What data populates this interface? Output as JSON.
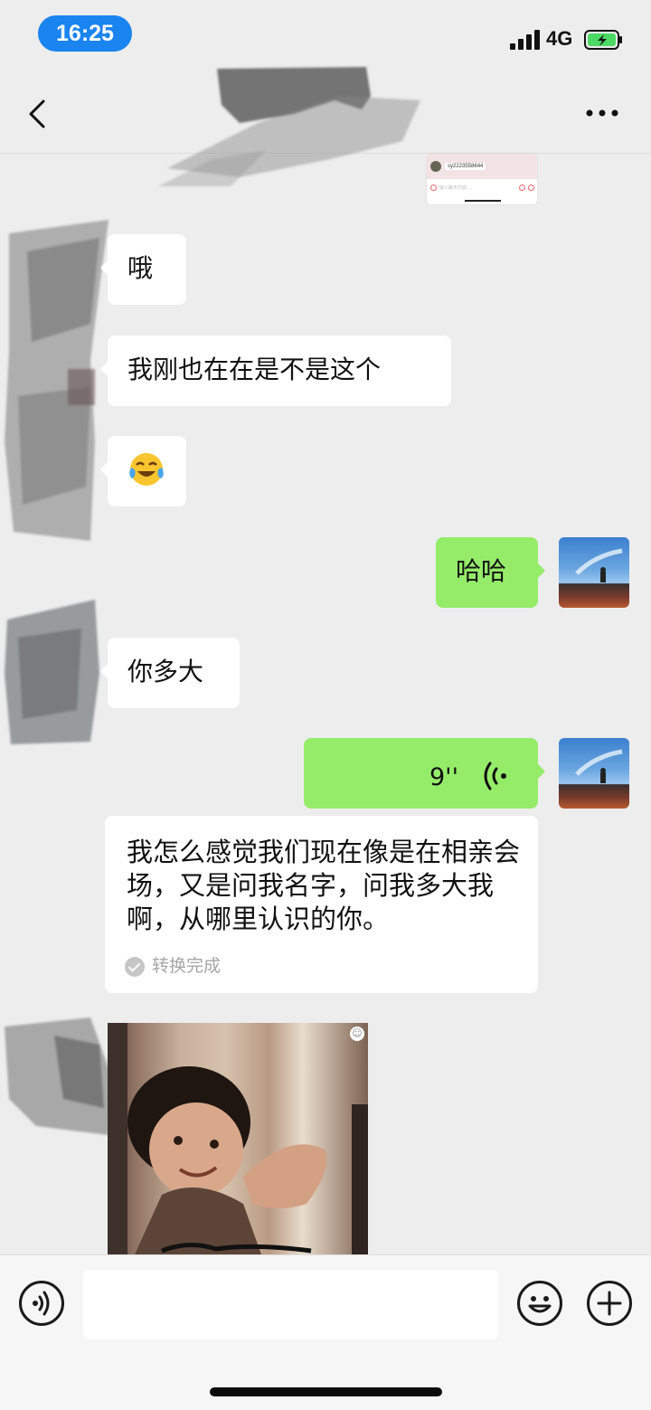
{
  "status_bar": {
    "time": "16:25",
    "network": "4G"
  },
  "header": {
    "back_icon": "chevron-left-icon",
    "more_icon": "more-dots-icon"
  },
  "screenshot_card": {
    "id_text": "sy2223558644",
    "input_placeholder": "输入聊天内容..."
  },
  "messages": [
    {
      "side": "left",
      "text": "哦"
    },
    {
      "side": "left",
      "text": "我刚也在在是不是这个"
    },
    {
      "side": "left",
      "type": "emoji",
      "emoji": "😂"
    },
    {
      "side": "right",
      "text": "哈哈"
    },
    {
      "side": "left",
      "text": "你多大"
    },
    {
      "side": "right",
      "type": "voice",
      "duration": "9''"
    }
  ],
  "transcript": {
    "text": "我怎么感觉我们现在像是在相亲会场，又是问我名字，问我多大我啊，从哪里认识的你。",
    "status": "转换完成"
  },
  "sticker": {
    "icon": "smiley-badge-icon"
  },
  "input_bar": {
    "voice_icon": "voice-toggle-icon",
    "emoji_icon": "emoji-icon",
    "plus_icon": "plus-icon",
    "placeholder": ""
  },
  "colors": {
    "background": "#ededed",
    "self_bubble": "#95ec69",
    "other_bubble": "#ffffff",
    "time_pill": "#1a84f0"
  }
}
